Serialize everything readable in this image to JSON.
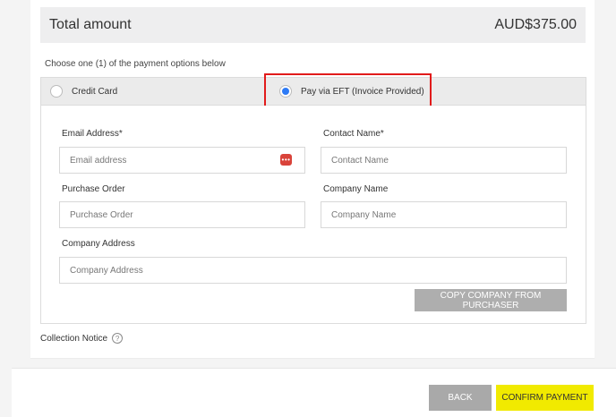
{
  "total": {
    "label": "Total amount",
    "value": "AUD$375.00"
  },
  "payment": {
    "instruction": "Choose one (1) of the payment options below",
    "options": [
      {
        "label": "Credit Card",
        "selected": false
      },
      {
        "label": "Pay via EFT (Invoice Provided)",
        "selected": true
      }
    ]
  },
  "form": {
    "email": {
      "label": "Email Address*",
      "placeholder": "Email address",
      "value": ""
    },
    "contact": {
      "label": "Contact Name*",
      "placeholder": "Contact Name",
      "value": ""
    },
    "purchase_order": {
      "label": "Purchase Order",
      "placeholder": "Purchase Order",
      "value": ""
    },
    "company_name": {
      "label": "Company Name",
      "placeholder": "Company Name",
      "value": ""
    },
    "company_address": {
      "label": "Company Address",
      "placeholder": "Company Address",
      "value": ""
    },
    "password_manager_icon": "password-manager-icon",
    "copy_button": "COPY COMPANY FROM PURCHASER"
  },
  "collection_notice": {
    "label": "Collection Notice",
    "icon": "help-icon",
    "icon_glyph": "?"
  },
  "footer": {
    "back": "BACK",
    "confirm": "CONFIRM PAYMENT"
  },
  "colors": {
    "accent_radio": "#2e7bf6",
    "highlight_border": "#e11b1b",
    "confirm_bg": "#f1ea00",
    "back_bg": "#a9a9a9"
  }
}
